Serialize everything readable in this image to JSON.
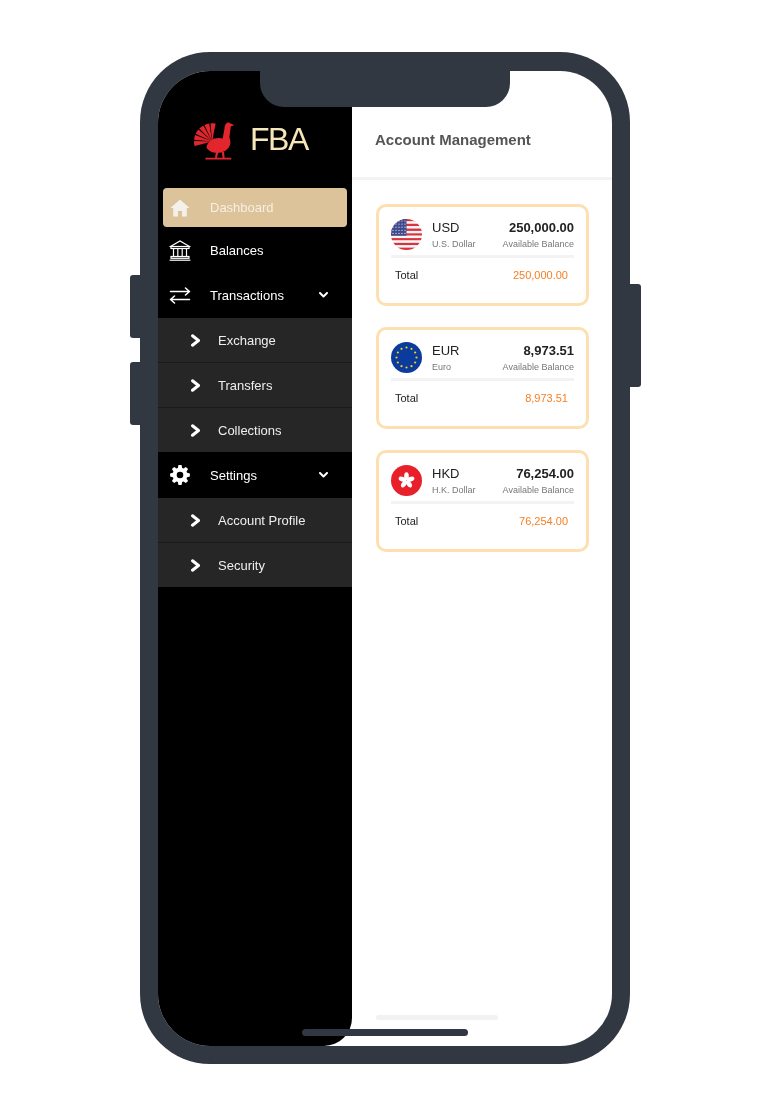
{
  "brand": {
    "name": "FBA"
  },
  "sidebar": {
    "items": [
      {
        "kind": "link",
        "label": "Dashboard",
        "selected": true
      },
      {
        "kind": "link",
        "label": "Balances",
        "selected": false
      },
      {
        "kind": "group",
        "label": "Transactions",
        "selected": false,
        "expanded": true,
        "children": [
          {
            "label": "Exchange",
            "selected": false
          },
          {
            "label": "Transfers",
            "selected": false
          },
          {
            "label": "Collections",
            "selected": false
          }
        ]
      },
      {
        "kind": "group",
        "label": "Settings",
        "selected": false,
        "expanded": true,
        "children": [
          {
            "label": "Account Profile",
            "selected": false
          },
          {
            "label": "Security",
            "selected": false
          }
        ]
      }
    ]
  },
  "header": {
    "title": "Account Management"
  },
  "accounts": [
    {
      "kind": "us",
      "code": "USD",
      "name": "U.S. Dollar",
      "balance": "250,000.00",
      "balance_label": "Available Balance",
      "total_label": "Total",
      "total": "250,000.00"
    },
    {
      "kind": "eu",
      "code": "EUR",
      "name": "Euro",
      "balance": "8,973.51",
      "balance_label": "Available Balance",
      "total_label": "Total",
      "total": "8,973.51"
    },
    {
      "kind": "hk",
      "code": "HKD",
      "name": "H.K. Dollar",
      "balance": "76,254.00",
      "balance_label": "Available Balance",
      "total_label": "Total",
      "total": "76,254.00"
    }
  ]
}
